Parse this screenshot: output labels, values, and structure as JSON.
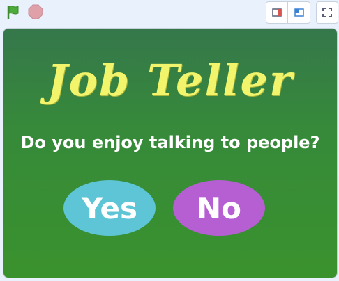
{
  "toolbar": {
    "green_flag_icon": "green-flag-icon",
    "stop_icon": "stop-icon",
    "small_stage_icon": "small-stage-icon",
    "large_stage_icon": "large-stage-icon",
    "fullscreen_icon": "fullscreen-icon"
  },
  "stage": {
    "title": "Job Teller",
    "question": "Do you enjoy talking to people?",
    "yes_label": "Yes",
    "no_label": "No"
  },
  "colors": {
    "flag": "#4cab3a",
    "stop": "#e0a0aa",
    "title": "#f2f56c",
    "yes": "#5ec5d6",
    "no": "#b65fd3"
  }
}
